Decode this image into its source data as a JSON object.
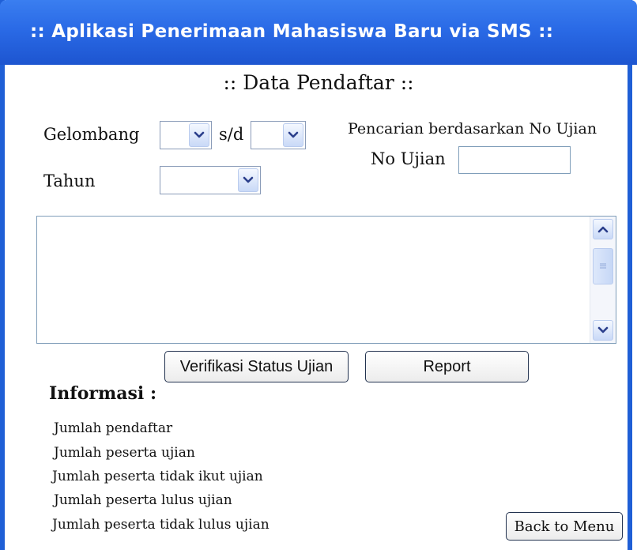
{
  "window": {
    "title": ":: Aplikasi Penerimaan Mahasiswa Baru via SMS ::"
  },
  "page": {
    "heading": ":: Data Pendaftar ::"
  },
  "filters": {
    "gelombang_label": "Gelombang",
    "range_separator": "s/d",
    "tahun_label": "Tahun",
    "gelombang_from": "",
    "gelombang_to": "",
    "tahun": ""
  },
  "search": {
    "title": "Pencarian berdasarkan No Ujian",
    "no_ujian_label": "No Ujian",
    "no_ujian_value": ""
  },
  "buttons": {
    "verify": "Verifikasi Status Ujian",
    "report": "Report",
    "back": "Back to Menu"
  },
  "info": {
    "heading": "Informasi :",
    "lines": [
      "Jumlah pendaftar",
      "Jumlah peserta ujian",
      "Jumlah peserta tidak ikut ujian",
      "Jumlah peserta lulus ujian",
      "Jumlah peserta tidak lulus ujian"
    ]
  },
  "icons": {
    "dropdown": "chevron-down-icon",
    "scroll_up": "chevron-up-icon",
    "scroll_down": "chevron-down-icon",
    "thumb": "grip-icon"
  },
  "colors": {
    "titlebar": "#2a6ae6",
    "window_border": "#1f5fd6",
    "control_border": "#7f9db9"
  }
}
